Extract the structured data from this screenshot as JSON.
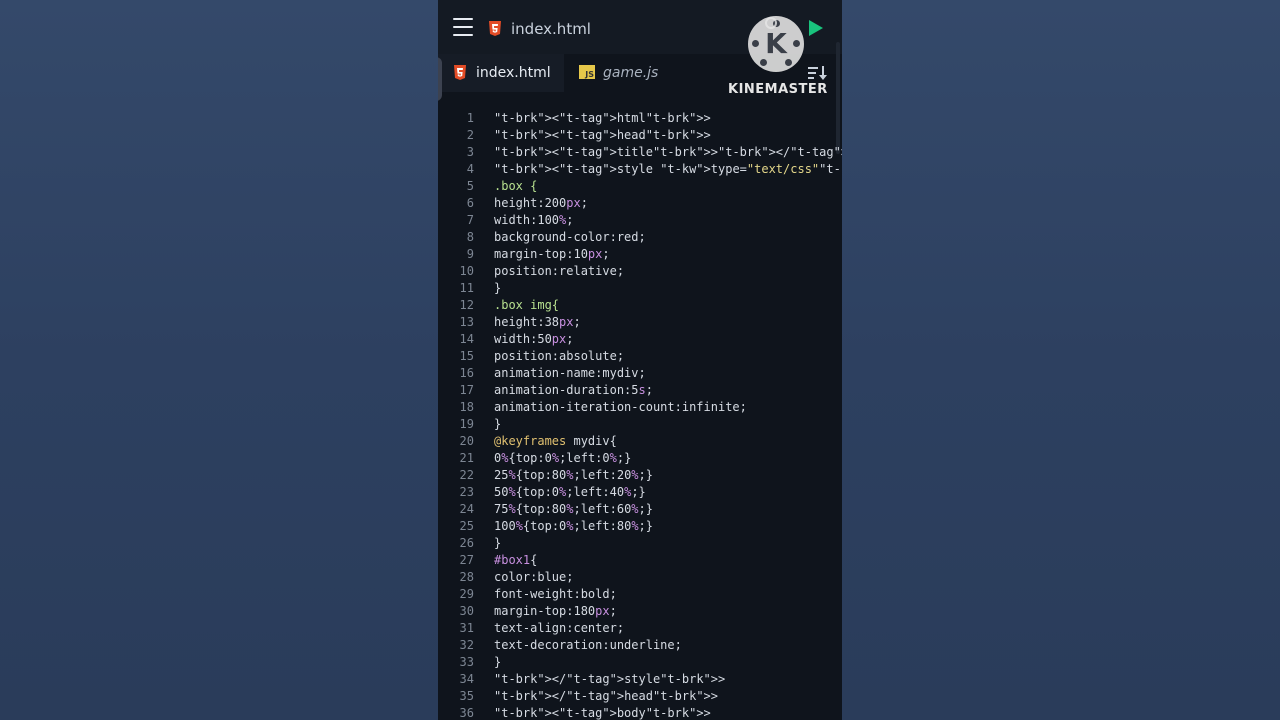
{
  "header": {
    "file_title": "index.html",
    "watermark": "KINEMASTER",
    "watermark_letter": "K"
  },
  "tabs": [
    {
      "label": "index.html",
      "active": true,
      "icon": "html5-icon"
    },
    {
      "label": "game.js",
      "active": false,
      "icon": "js-icon",
      "icon_text": "JS"
    }
  ],
  "colors": {
    "background": "#2f4362",
    "editor_bg": "#0f141c",
    "run_green": "#19c37d",
    "html5_orange": "#e34c26",
    "js_yellow": "#e6c84a"
  },
  "code_lines": [
    {
      "n": "1",
      "text": "<html>"
    },
    {
      "n": "2",
      "text": "<head>"
    },
    {
      "n": "3",
      "text": "<title></title>"
    },
    {
      "n": "4",
      "text": "<style type=\"text/css\">"
    },
    {
      "n": "5",
      "text": ".box {"
    },
    {
      "n": "6",
      "text": "height:200px;"
    },
    {
      "n": "7",
      "text": "width:100%;"
    },
    {
      "n": "8",
      "text": "background-color:red;"
    },
    {
      "n": "9",
      "text": "margin-top:10px;"
    },
    {
      "n": "10",
      "text": "position:relative;"
    },
    {
      "n": "11",
      "text": "}"
    },
    {
      "n": "12",
      "text": ".box img{"
    },
    {
      "n": "13",
      "text": "height:38px;"
    },
    {
      "n": "14",
      "text": "width:50px;"
    },
    {
      "n": "15",
      "text": "position:absolute;"
    },
    {
      "n": "16",
      "text": "animation-name:mydiv;"
    },
    {
      "n": "17",
      "text": "animation-duration:5s;"
    },
    {
      "n": "18",
      "text": "animation-iteration-count:infinite;"
    },
    {
      "n": "19",
      "text": "}"
    },
    {
      "n": "20",
      "text": "@keyframes mydiv{"
    },
    {
      "n": "21",
      "text": "0%{top:0%;left:0%;}"
    },
    {
      "n": "22",
      "text": "25%{top:80%;left:20%;}"
    },
    {
      "n": "23",
      "text": "50%{top:0%;left:40%;}"
    },
    {
      "n": "24",
      "text": "75%{top:80%;left:60%;}"
    },
    {
      "n": "25",
      "text": "100%{top:0%;left:80%;}"
    },
    {
      "n": "26",
      "text": "}"
    },
    {
      "n": "27",
      "text": "#box1{"
    },
    {
      "n": "28",
      "text": "color:blue;"
    },
    {
      "n": "29",
      "text": "font-weight:bold;"
    },
    {
      "n": "30",
      "text": "margin-top:180px;"
    },
    {
      "n": "31",
      "text": "text-align:center;"
    },
    {
      "n": "32",
      "text": "text-decoration:underline;"
    },
    {
      "n": "33",
      "text": "}"
    },
    {
      "n": "34",
      "text": "</style>"
    },
    {
      "n": "35",
      "text": "</head>"
    },
    {
      "n": "36",
      "text": "<body>"
    }
  ]
}
